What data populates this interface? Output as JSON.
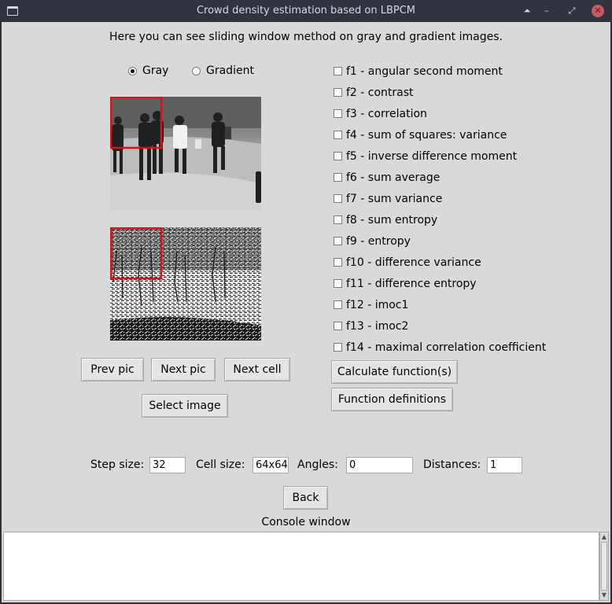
{
  "window": {
    "title": "Crowd density estimation based on LBPCM",
    "controls": [
      "⏶",
      "–",
      "⤢",
      "✕"
    ]
  },
  "heading": "Here you can see sliding window method on gray and gradient images.",
  "image_mode": {
    "options": [
      {
        "label": "Gray",
        "selected": true
      },
      {
        "label": "Gradient",
        "selected": false
      }
    ]
  },
  "images": {
    "gray_alt": "gray crowd image with sliding window",
    "gradient_alt": "gradient crowd image with sliding window",
    "window_color": "#e01010"
  },
  "nav_buttons": {
    "prev": "Prev pic",
    "next": "Next pic",
    "next_cell": "Next cell",
    "select_image": "Select image"
  },
  "features": [
    {
      "label": "f1 - angular second moment",
      "checked": false
    },
    {
      "label": "f2 - contrast",
      "checked": false
    },
    {
      "label": "f3 - correlation",
      "checked": false
    },
    {
      "label": "f4 - sum of squares: variance",
      "checked": false
    },
    {
      "label": "f5 - inverse difference moment",
      "checked": false
    },
    {
      "label": "f6 - sum average",
      "checked": false
    },
    {
      "label": "f7 - sum variance",
      "checked": false
    },
    {
      "label": "f8 - sum entropy",
      "checked": false
    },
    {
      "label": "f9 - entropy",
      "checked": false
    },
    {
      "label": "f10 - difference variance",
      "checked": false
    },
    {
      "label": "f11 - difference entropy",
      "checked": false
    },
    {
      "label": "f12 - imoc1",
      "checked": false
    },
    {
      "label": "f13 - imoc2",
      "checked": false
    },
    {
      "label": "f14 - maximal correlation coefficient",
      "checked": false
    }
  ],
  "function_buttons": {
    "calculate": "Calculate function(s)",
    "definitions": "Function definitions"
  },
  "params": {
    "step_size_label": "Step size:",
    "step_size_value": "32",
    "cell_size_label": "Cell size:",
    "cell_size_value": "64x64",
    "angles_label": "Angles:",
    "angles_value": "0",
    "distances_label": "Distances:",
    "distances_value": "1"
  },
  "back_button": "Back",
  "console_label": "Console window",
  "console_text": ""
}
